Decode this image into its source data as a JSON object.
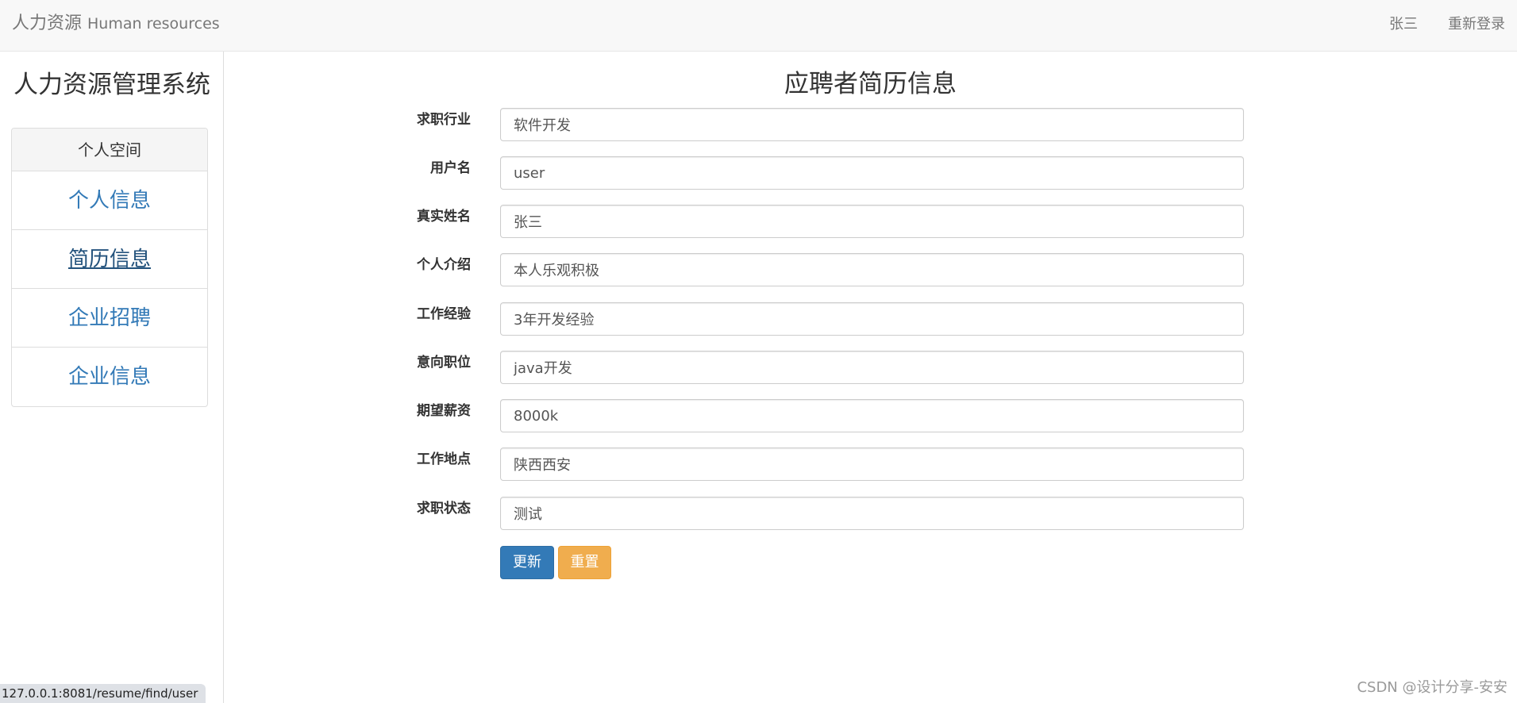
{
  "navbar": {
    "brand_cn": "人力资源",
    "brand_en": "Human resources",
    "user_name": "张三",
    "relogin_label": "重新登录"
  },
  "sidebar": {
    "title": "人力资源管理系统",
    "panel_heading": "个人空间",
    "items": [
      {
        "label": "个人信息"
      },
      {
        "label": "简历信息"
      },
      {
        "label": "企业招聘"
      },
      {
        "label": "企业信息"
      }
    ]
  },
  "main": {
    "title": "应聘者简历信息",
    "fields": [
      {
        "label": "求职行业",
        "value": "软件开发"
      },
      {
        "label": "用户名",
        "value": "user"
      },
      {
        "label": "真实姓名",
        "value": "张三"
      },
      {
        "label": "个人介绍",
        "value": "本人乐观积极"
      },
      {
        "label": "工作经验",
        "value": "3年开发经验"
      },
      {
        "label": "意向职位",
        "value": "java开发"
      },
      {
        "label": "期望薪资",
        "value": "8000k"
      },
      {
        "label": "工作地点",
        "value": "陕西西安"
      },
      {
        "label": "求职状态",
        "value": "测试"
      }
    ],
    "update_label": "更新",
    "reset_label": "重置"
  },
  "status": {
    "url": "127.0.0.1:8081/resume/find/user"
  },
  "watermark": "CSDN @设计分享-安安",
  "colors": {
    "link": "#337ab7",
    "primary": "#337ab7",
    "warning": "#f0ad4e"
  }
}
